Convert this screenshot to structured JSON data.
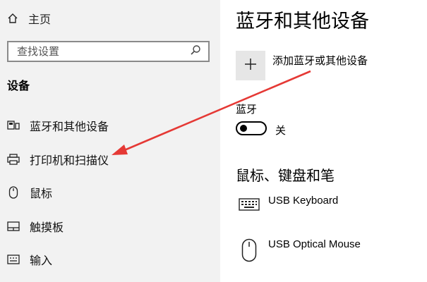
{
  "sidebar": {
    "home_label": "主页",
    "search_placeholder": "查找设置",
    "section_title": "设备",
    "items": [
      {
        "label": "蓝牙和其他设备",
        "icon": "bluetooth-devices-icon"
      },
      {
        "label": "打印机和扫描仪",
        "icon": "printer-icon"
      },
      {
        "label": "鼠标",
        "icon": "mouse-icon"
      },
      {
        "label": "触摸板",
        "icon": "touchpad-icon"
      },
      {
        "label": "输入",
        "icon": "keyboard-input-icon"
      }
    ]
  },
  "main": {
    "title": "蓝牙和其他设备",
    "add_device_label": "添加蓝牙或其他设备",
    "bluetooth_label": "蓝牙",
    "bluetooth_state": "关",
    "bluetooth_on": false,
    "section_title": "鼠标、键盘和笔",
    "devices": [
      {
        "name": "USB Keyboard",
        "icon": "keyboard-icon"
      },
      {
        "name": "USB Optical Mouse",
        "icon": "mouse-icon"
      }
    ]
  },
  "colors": {
    "sidebar_bg": "#f2f2f2",
    "main_bg": "#ffffff",
    "arrow": "#e53935",
    "tile_bg": "#e6e6e6"
  }
}
